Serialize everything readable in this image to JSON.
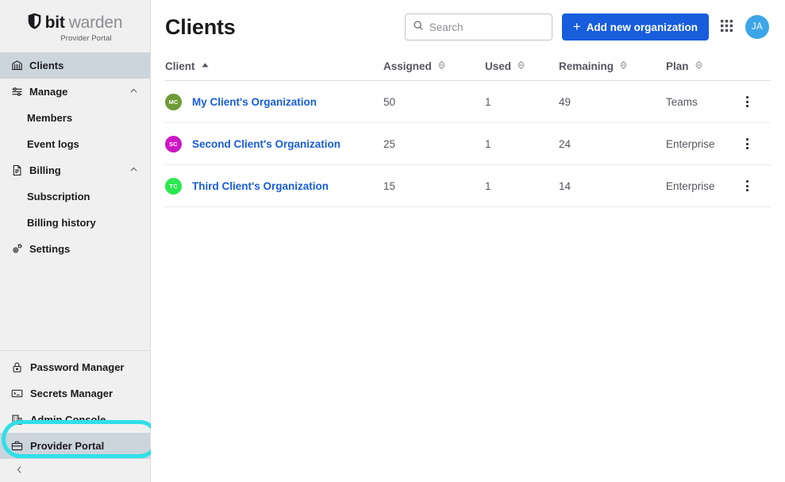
{
  "brand": {
    "name_bold": "bit",
    "name_light": "warden",
    "subtitle": "Provider Portal",
    "logo_icon": "shield-icon"
  },
  "colors": {
    "accent_blue": "#175ddc",
    "highlight_ring": "#2ee0e8",
    "active_nav_bg": "#ccd4dc",
    "sidebar_bg": "#f0f0f0",
    "header_avatar_bg": "#3da5e8"
  },
  "sidebar": {
    "items": [
      {
        "label": "Clients",
        "icon": "bank-icon",
        "active": true
      },
      {
        "label": "Manage",
        "icon": "sliders-icon",
        "expandable": true,
        "chevron": "chevron-up-icon"
      },
      {
        "label": "Members",
        "icon": "",
        "sub": true
      },
      {
        "label": "Event logs",
        "icon": "",
        "sub": true
      },
      {
        "label": "Billing",
        "icon": "invoice-icon",
        "expandable": true,
        "chevron": "chevron-up-icon"
      },
      {
        "label": "Subscription",
        "icon": "",
        "sub": true
      },
      {
        "label": "Billing history",
        "icon": "",
        "sub": true
      },
      {
        "label": "Settings",
        "icon": "gear-icon"
      }
    ],
    "products": [
      {
        "label": "Password Manager",
        "icon": "lock-icon",
        "current": false
      },
      {
        "label": "Secrets Manager",
        "icon": "terminal-icon",
        "current": false
      },
      {
        "label": "Admin Console",
        "icon": "building-icon",
        "current": false
      },
      {
        "label": "Provider Portal",
        "icon": "briefcase-icon",
        "current": true
      }
    ],
    "collapse_icon": "chevron-left-icon"
  },
  "header": {
    "title": "Clients",
    "search": {
      "placeholder": "Search",
      "value": "",
      "icon": "search-icon"
    },
    "add_button": {
      "label": "Add new organization",
      "icon": "plus-icon"
    },
    "app_switcher_icon": "grid-icon",
    "account_avatar": {
      "initials": "JA",
      "icon": "avatar"
    }
  },
  "table": {
    "columns": [
      {
        "label": "Client",
        "sort": "asc",
        "sort_icon": "sort-asc-active-icon"
      },
      {
        "label": "Assigned",
        "sort": "none",
        "sort_icon": "sort-icon"
      },
      {
        "label": "Used",
        "sort": "none",
        "sort_icon": "sort-icon"
      },
      {
        "label": "Remaining",
        "sort": "none",
        "sort_icon": "sort-icon"
      },
      {
        "label": "Plan",
        "sort": "none",
        "sort_icon": "sort-icon"
      }
    ],
    "rows": [
      {
        "avatar_initials": "MC",
        "avatar_color": "#6f9b34",
        "client": "My Client's Organization",
        "assigned": "50",
        "used": "1",
        "remaining": "49",
        "plan": "Teams",
        "menu_icon": "kebab-menu-icon"
      },
      {
        "avatar_initials": "SC",
        "avatar_color": "#cc17c4",
        "client": "Second Client's Organization",
        "assigned": "25",
        "used": "1",
        "remaining": "24",
        "plan": "Enterprise",
        "menu_icon": "kebab-menu-icon"
      },
      {
        "avatar_initials": "TC",
        "avatar_color": "#2ae84f",
        "client": "Third Client's Organization",
        "assigned": "15",
        "used": "1",
        "remaining": "14",
        "plan": "Enterprise",
        "menu_icon": "kebab-menu-icon"
      }
    ]
  }
}
